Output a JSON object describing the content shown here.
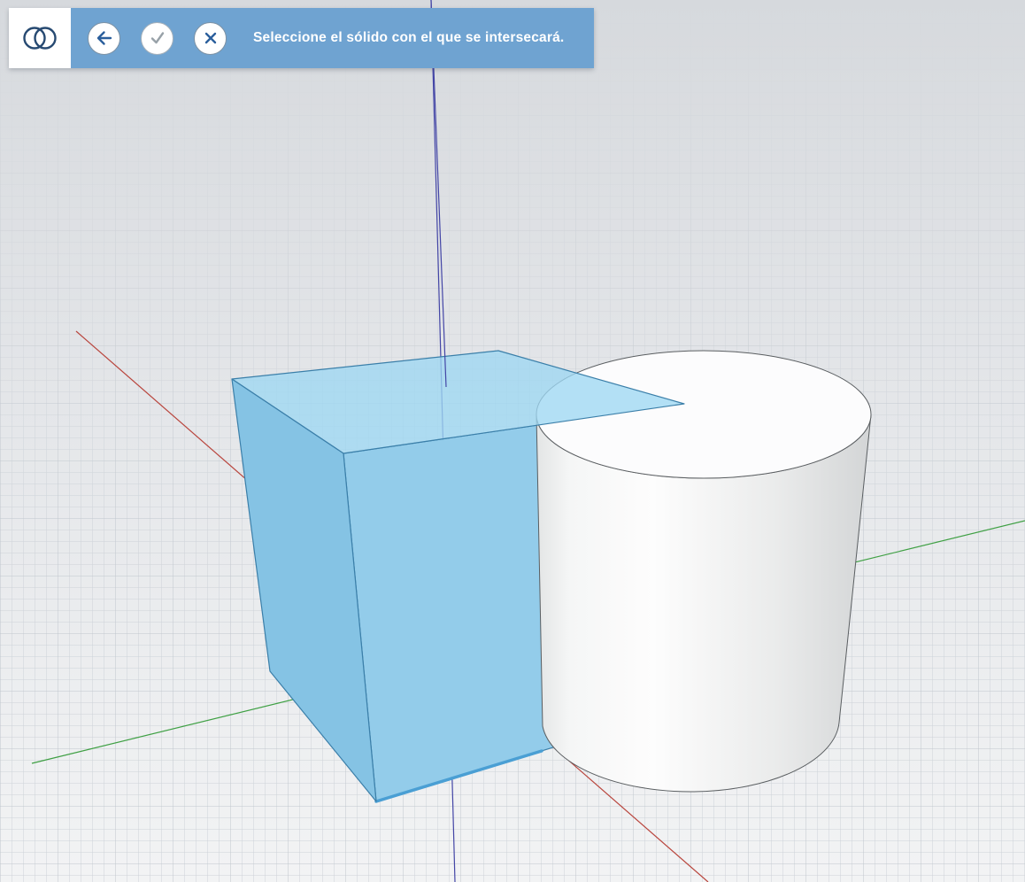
{
  "toolbar": {
    "active_tool": {
      "name": "intersect-solids",
      "icon": "intersect-solids-icon"
    },
    "prompt": "Seleccione el sólido con el que se intersecará.",
    "buttons": [
      {
        "id": "back",
        "icon": "arrow-left-icon"
      },
      {
        "id": "accept",
        "icon": "check-icon"
      },
      {
        "id": "cancel",
        "icon": "close-icon"
      }
    ],
    "colors": {
      "bar": "#6FA3D1",
      "text": "#FFFFFF",
      "tool_icon": "#274A72",
      "action_icon": "#2B5F9C",
      "muted_icon": "#98A1A8"
    }
  },
  "viewport": {
    "background": {
      "top": "#D6D9DD",
      "mid": "#E4E6E9",
      "bottom": "#F2F3F4"
    },
    "grid": {
      "minor_color": "#CDD2D8",
      "major_color": "#C0C6CD"
    },
    "axes": {
      "x": {
        "color": "#B9463E"
      },
      "y": {
        "color": "#3FA044"
      },
      "z": {
        "color": "#4345A6"
      }
    },
    "objects": {
      "cube": {
        "label": "cube",
        "state": "selected",
        "faces": {
          "top": "#9ED7F2",
          "left": "#85C3E4",
          "front": "#93CCEA"
        },
        "edge_color": "#3B7FA9",
        "bottom_edge_color": "#4A9FD4"
      },
      "cylinder": {
        "label": "cylinder",
        "state": "unselected",
        "top_fill": "#FCFCFD",
        "edge_color": "#5A5E61"
      }
    }
  }
}
